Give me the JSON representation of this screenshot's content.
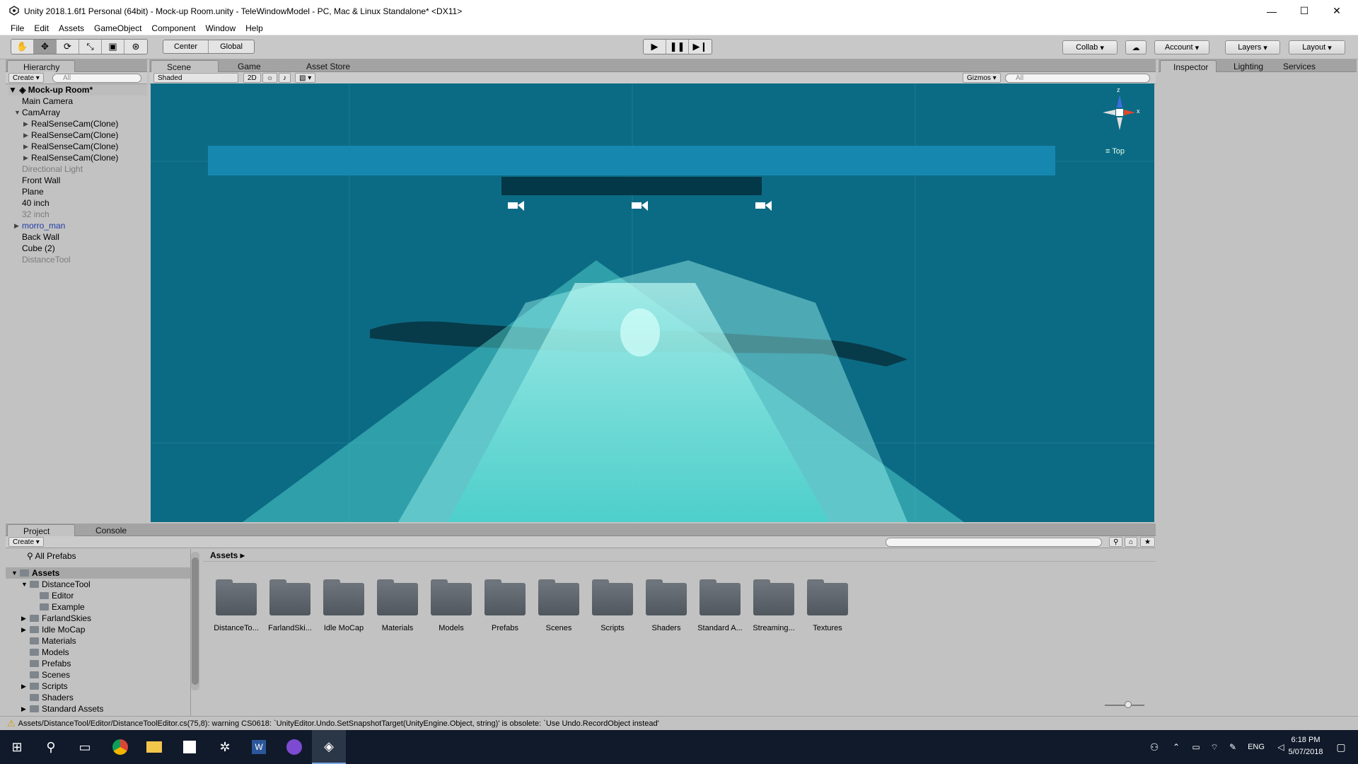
{
  "window": {
    "title": "Unity 2018.1.6f1 Personal (64bit) - Mock-up Room.unity - TeleWindowModel - PC, Mac & Linux Standalone* <DX11>",
    "min": "—",
    "max": "☐",
    "close": "✕"
  },
  "menu": [
    "File",
    "Edit",
    "Assets",
    "GameObject",
    "Component",
    "Window",
    "Help"
  ],
  "toolbar": {
    "center": "Center",
    "global": "Global",
    "collab": "Collab",
    "account": "Account",
    "layers": "Layers",
    "layout": "Layout"
  },
  "hierarchy": {
    "tab": "Hierarchy",
    "create": "Create",
    "search": "All",
    "scene": "Mock-up Room*",
    "items": [
      {
        "label": "Main Camera",
        "indent": 0,
        "style": ""
      },
      {
        "label": "CamArray",
        "indent": 0,
        "style": "",
        "arrow": "▼"
      },
      {
        "label": "RealSenseCam(Clone)",
        "indent": 1,
        "style": "",
        "arrow": "▶"
      },
      {
        "label": "RealSenseCam(Clone)",
        "indent": 1,
        "style": "",
        "arrow": "▶"
      },
      {
        "label": "RealSenseCam(Clone)",
        "indent": 1,
        "style": "",
        "arrow": "▶"
      },
      {
        "label": "RealSenseCam(Clone)",
        "indent": 1,
        "style": "",
        "arrow": "▶"
      },
      {
        "label": "Directional Light",
        "indent": 0,
        "style": "gray"
      },
      {
        "label": "Front Wall",
        "indent": 0,
        "style": ""
      },
      {
        "label": "Plane",
        "indent": 0,
        "style": ""
      },
      {
        "label": "40 inch",
        "indent": 0,
        "style": ""
      },
      {
        "label": "32 inch",
        "indent": 0,
        "style": "gray"
      },
      {
        "label": "morro_man",
        "indent": 0,
        "style": "blue",
        "arrow": "▶"
      },
      {
        "label": "Back Wall",
        "indent": 0,
        "style": ""
      },
      {
        "label": "Cube (2)",
        "indent": 0,
        "style": ""
      },
      {
        "label": "DistanceTool",
        "indent": 0,
        "style": "gray"
      }
    ]
  },
  "sceneTabs": {
    "scene": "Scene",
    "game": "Game",
    "store": "Asset Store",
    "shaded": "Shaded",
    "twoD": "2D",
    "gizmos": "Gizmos",
    "search": "All",
    "gizmoLabel": "Top",
    "axisZ": "z",
    "axisX": "x"
  },
  "rightTabs": {
    "inspector": "Inspector",
    "lighting": "Lighting",
    "services": "Services"
  },
  "project": {
    "tab": "Project",
    "console": "Console",
    "create": "Create",
    "allPrefabs": "All Prefabs",
    "breadcrumb": "Assets",
    "tree": [
      {
        "label": "Assets",
        "indent": 0,
        "arrow": "▼",
        "sel": true
      },
      {
        "label": "DistanceTool",
        "indent": 1,
        "arrow": "▼"
      },
      {
        "label": "Editor",
        "indent": 2
      },
      {
        "label": "Example",
        "indent": 2
      },
      {
        "label": "FarlandSkies",
        "indent": 1,
        "arrow": "▶"
      },
      {
        "label": "Idle MoCap",
        "indent": 1,
        "arrow": "▶"
      },
      {
        "label": "Materials",
        "indent": 1
      },
      {
        "label": "Models",
        "indent": 1
      },
      {
        "label": "Prefabs",
        "indent": 1
      },
      {
        "label": "Scenes",
        "indent": 1
      },
      {
        "label": "Scripts",
        "indent": 1,
        "arrow": "▶"
      },
      {
        "label": "Shaders",
        "indent": 1
      },
      {
        "label": "Standard Assets",
        "indent": 1,
        "arrow": "▶"
      }
    ],
    "folders": [
      "DistanceTo...",
      "FarlandSki...",
      "Idle MoCap",
      "Materials",
      "Models",
      "Prefabs",
      "Scenes",
      "Scripts",
      "Shaders",
      "Standard A...",
      "Streaming...",
      "Textures"
    ]
  },
  "status": "Assets/DistanceTool/Editor/DistanceToolEditor.cs(75,8): warning CS0618: `UnityEditor.Undo.SetSnapshotTarget(UnityEngine.Object, string)' is obsolete: `Use Undo.RecordObject instead'",
  "taskbar": {
    "time": "6:18 PM",
    "date": "5/07/2018",
    "lang": "ENG"
  }
}
